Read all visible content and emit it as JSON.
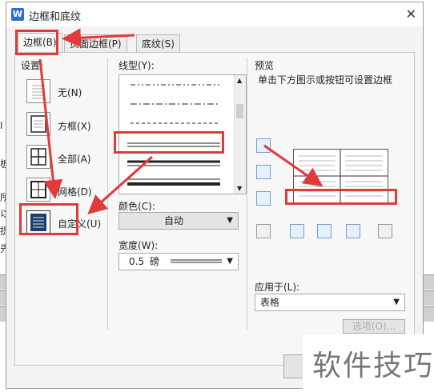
{
  "background": {
    "left_text": [
      "I",
      "板",
      "所",
      "以",
      "提",
      "先"
    ]
  },
  "dialog": {
    "app_icon_letter": "W",
    "title": "边框和底纹",
    "close_glyph": "✕",
    "tabs": [
      {
        "label": "边框(B)",
        "active": true
      },
      {
        "label": "页面边框(P)",
        "active": false
      },
      {
        "label": "底纹(S)",
        "active": false
      }
    ],
    "settings": {
      "heading": "设置:",
      "items": [
        {
          "label": "无(N)"
        },
        {
          "label": "方框(X)"
        },
        {
          "label": "全部(A)"
        },
        {
          "label": "网格(D)"
        },
        {
          "label": "自定义(U)"
        }
      ]
    },
    "line_style": {
      "heading": "线型(Y):",
      "styles": [
        "dash-dot-dot",
        "dash-dot",
        "dash",
        "double",
        "thick-thin",
        "thin-thick"
      ]
    },
    "color": {
      "heading": "颜色(C):",
      "value": "自动"
    },
    "width": {
      "heading": "宽度(W):",
      "value": "0.5",
      "unit": "磅"
    },
    "preview": {
      "heading": "预览",
      "hint": "单击下方图示或按钮可设置边框"
    },
    "apply_to": {
      "heading": "应用于(L):",
      "value": "表格"
    },
    "options_button": "选项(O)..."
  },
  "watermark": "软件技巧",
  "colors": {
    "annotation_red": "#e03a3a",
    "accent_blue": "#2b6fd6"
  }
}
